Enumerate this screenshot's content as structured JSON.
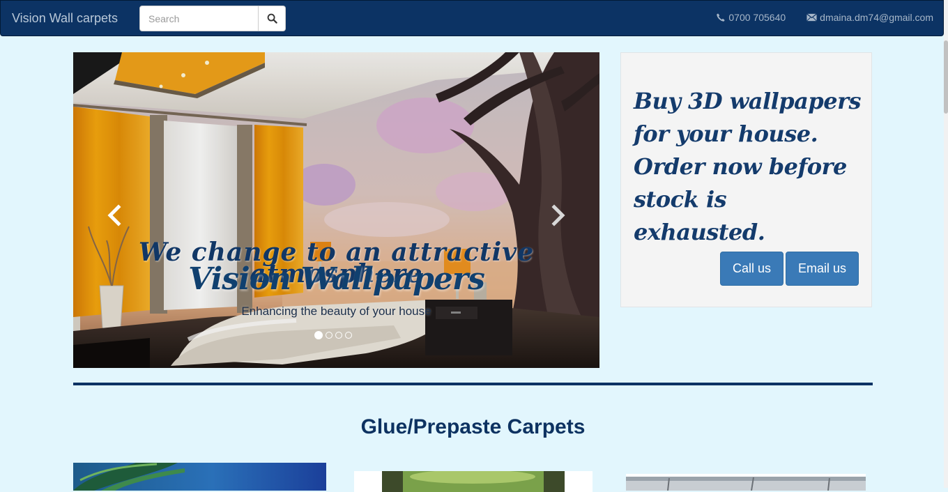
{
  "navbar": {
    "brand": "Vision Wall carpets",
    "search": {
      "placeholder": "Search",
      "value": ""
    },
    "phone": "0700 705640",
    "email": "dmaina.dm74@gmail.com"
  },
  "carousel": {
    "headline": "We change to an attractive atmosphere",
    "brand": "Vision Wallpapers",
    "tagline": "Enhancing the beauty of your house",
    "slide_count": 4,
    "active_slide": 1
  },
  "promo": {
    "text": "Buy 3D wallpapers for your house. Order now before stock is exhausted.",
    "call_label": "Call us",
    "email_label": "Email us"
  },
  "section": {
    "title": "Glue/Prepaste Carpets"
  },
  "colors": {
    "navbar": "#0c3364",
    "page_bg": "#e2f6fd",
    "accent": "#3a7ab7",
    "heading": "#0d3261"
  }
}
